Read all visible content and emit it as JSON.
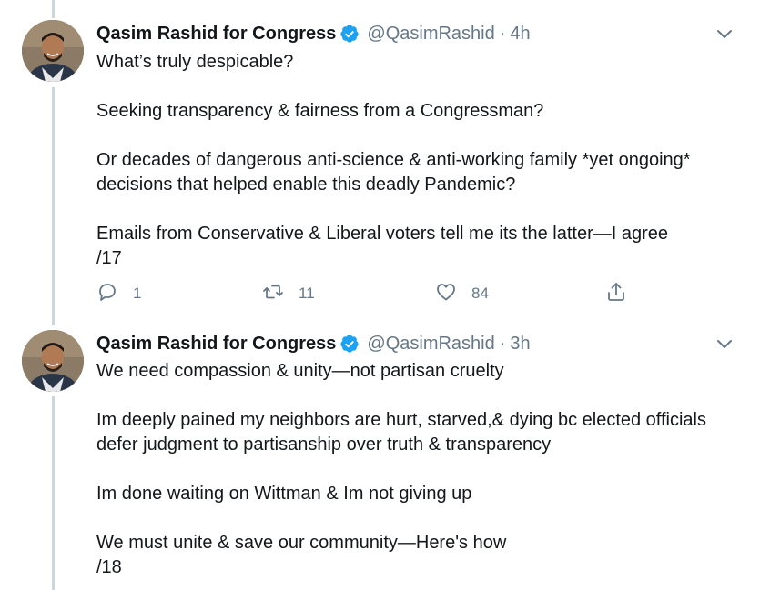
{
  "colors": {
    "accent": "#1da1f2",
    "text": "#14171a",
    "muted": "#657786",
    "thread_line": "#ccd6dd"
  },
  "tweets": [
    {
      "name": "Qasim Rashid for Congress",
      "handle": "@QasimRashid",
      "separator": "·",
      "time": "4h",
      "paragraphs": [
        "What’s truly despicable?",
        "Seeking transparency & fairness from a Congressman?",
        "Or decades of dangerous anti-science & anti-working family *yet ongoing* decisions that helped enable this deadly Pandemic?",
        "Emails from Conservative & Liberal voters tell me its the latter—I agree\n/17"
      ],
      "replies": "1",
      "retweets": "11",
      "likes": "84"
    },
    {
      "name": "Qasim Rashid for Congress",
      "handle": "@QasimRashid",
      "separator": "·",
      "time": "3h",
      "paragraphs": [
        "We need compassion & unity—not partisan cruelty",
        "Im deeply pained my neighbors are hurt, starved,& dying bc elected officials defer judgment to partisanship over truth & transparency",
        "Im done waiting on Wittman & Im not giving up",
        "We must unite & save our community—Here's how\n/18"
      ]
    }
  ],
  "icons": {
    "verified": "verified-badge-icon",
    "caret": "chevron-down-icon",
    "reply": "reply-icon",
    "retweet": "retweet-icon",
    "like": "heart-icon",
    "share": "share-icon"
  }
}
